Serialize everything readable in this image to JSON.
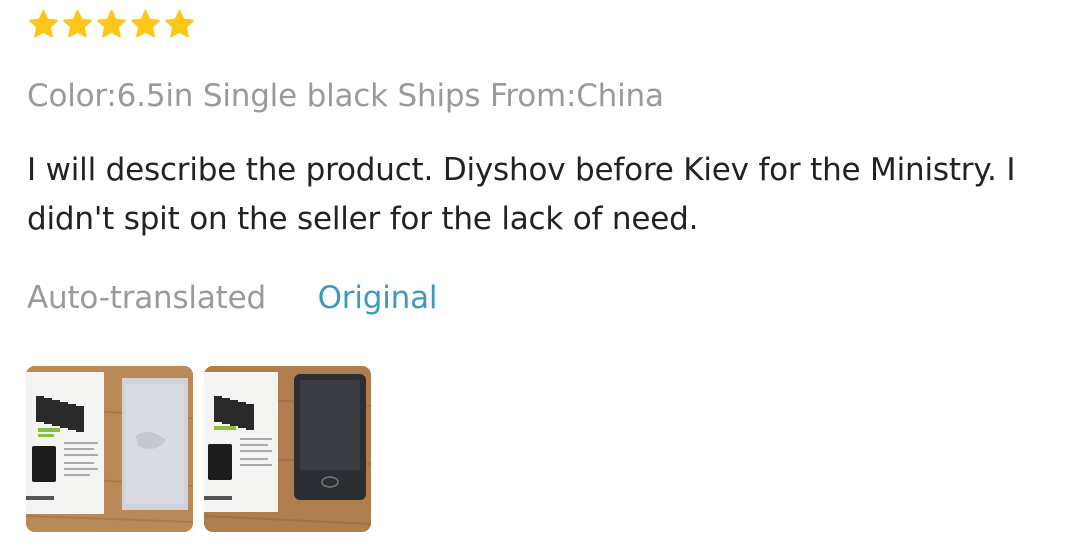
{
  "rating": {
    "stars": 5,
    "max": 5,
    "color": "#fcc718"
  },
  "sku_info": "Color:6.5in Single black Ships From:China",
  "review_text": "I will describe the product. Diyshov before Kiev for the Ministry. I didn't spit on the seller for the lack of need.",
  "translation": {
    "status_label": "Auto-translated",
    "original_link": "Original"
  },
  "photos": [
    {
      "name": "review-photo-1",
      "icon": "manual-and-protective-film-photo"
    },
    {
      "name": "review-photo-2",
      "icon": "manual-and-lcd-tablet-photo"
    }
  ],
  "colors": {
    "text": "#222222",
    "muted": "#9a9a9a",
    "link": "#3a9bbd"
  }
}
